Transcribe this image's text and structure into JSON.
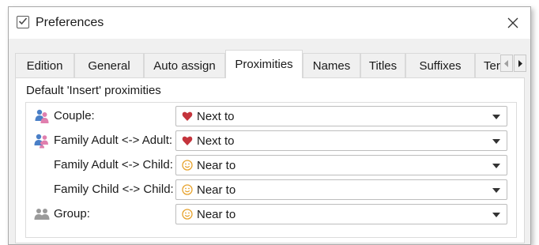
{
  "window": {
    "title": "Preferences"
  },
  "tabs": [
    {
      "label": "Edition",
      "active": false
    },
    {
      "label": "General",
      "active": false
    },
    {
      "label": "Auto assign",
      "active": false
    },
    {
      "label": "Proximities",
      "active": true
    },
    {
      "label": "Names",
      "active": false
    },
    {
      "label": "Titles",
      "active": false
    },
    {
      "label": "Suffixes",
      "active": false
    },
    {
      "label": "Term",
      "active": false
    }
  ],
  "panel": {
    "section_label": "Default 'Insert' proximities",
    "rows": [
      {
        "label": "Couple:",
        "row_icon": "couple-icon",
        "value": "Next to",
        "value_icon": "heart-icon"
      },
      {
        "label": "Family Adult <-> Adult:",
        "row_icon": "family-icon",
        "value": "Next to",
        "value_icon": "heart-icon"
      },
      {
        "label": "Family Adult <-> Child:",
        "row_icon": "",
        "value": "Near to",
        "value_icon": "smiley-icon"
      },
      {
        "label": "Family Child <-> Child:",
        "row_icon": "",
        "value": "Near to",
        "value_icon": "smiley-icon"
      },
      {
        "label": "Group:",
        "row_icon": "group-icon",
        "value": "Near to",
        "value_icon": "smiley-icon"
      }
    ]
  },
  "colors": {
    "heart": "#c4343c",
    "smiley": "#e7a22b",
    "person_blue": "#4a7fc7",
    "person_pink": "#e07fae",
    "group_gray": "#9a9a9a"
  }
}
